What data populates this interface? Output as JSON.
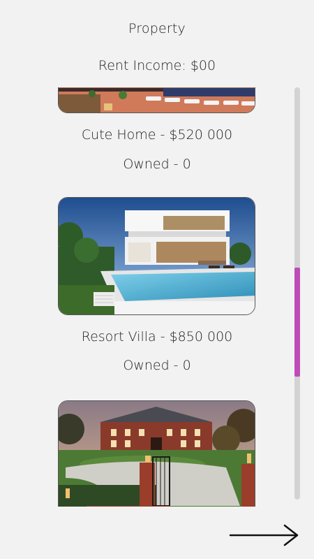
{
  "header": {
    "title": "Property",
    "rent_income": "Rent Income: $00"
  },
  "properties": [
    {
      "name_price": "Cute Home - $520 000",
      "owned": "Owned - 0",
      "image": "modern-pool-house-photo"
    },
    {
      "name_price": "Resort Villa - $850 000",
      "owned": "Owned - 0",
      "image": "white-villa-with-pool-photo"
    },
    {
      "image": "brick-mansion-photo"
    }
  ],
  "scrollbar": {
    "thumb_color": "#bf4bb8",
    "track_color": "#d3d3d3",
    "position_fraction": 0.43,
    "visible_fraction": 0.26
  },
  "navigation": {
    "next_icon": "right-arrow-icon"
  }
}
